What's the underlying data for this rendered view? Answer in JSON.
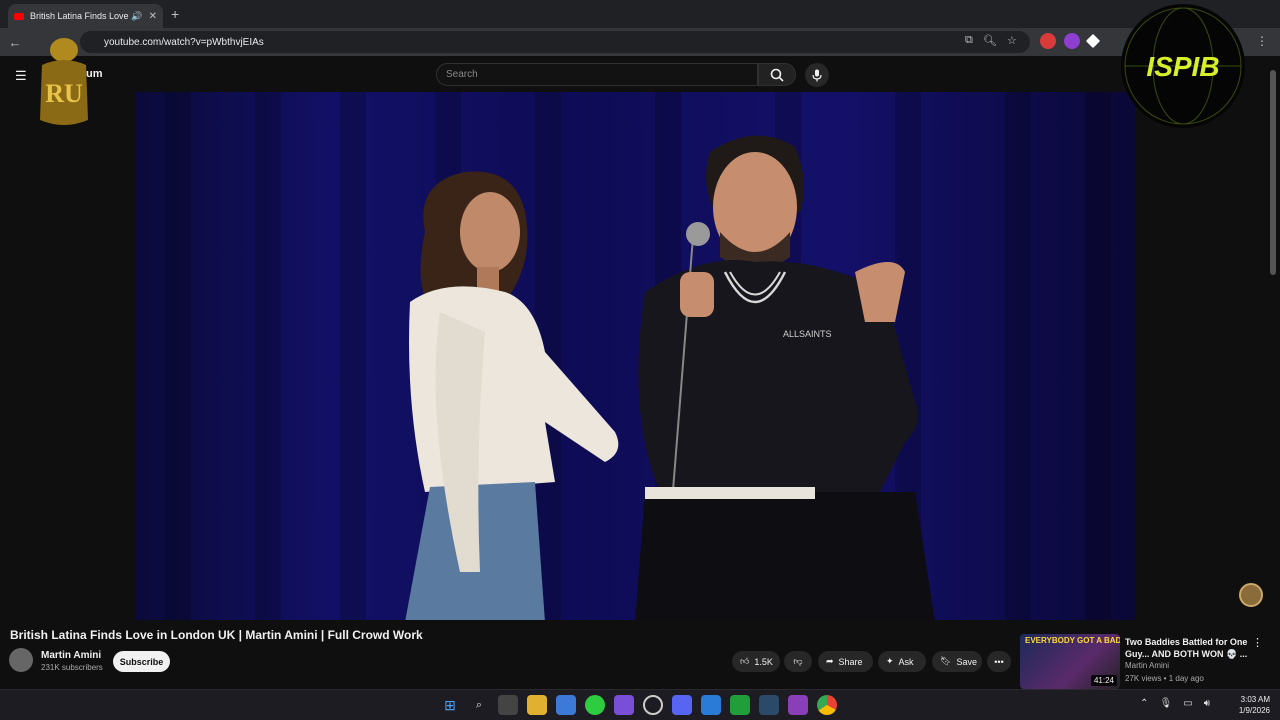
{
  "browser": {
    "tab_title": "British Latina Finds Love in",
    "url": "youtube.com/watch?v=pWbthvjEIAs"
  },
  "youtube": {
    "logo_suffix": "um",
    "search_placeholder": "Search"
  },
  "video": {
    "title": "British Latina Finds Love in London UK | Martin Amini | Full Crowd Work",
    "channel": "Martin Amini",
    "subscribers": "231K subscribers",
    "subscribe_label": "Subscribe",
    "likes": "1.5K",
    "share_label": "Share",
    "ask_label": "Ask",
    "save_label": "Save",
    "shirt_text": "ALLSAINTS"
  },
  "related": {
    "thumb_text": "EVERYBODY GOT A BADDIE",
    "title": "Two Baddies Battled for One Guy... AND BOTH WON 💀 ...",
    "channel": "Martin Amini",
    "meta": "27K views • 1 day ago",
    "duration": "41:24"
  },
  "watermarks": {
    "left_text": "RU",
    "right_text": "ISPIB"
  },
  "taskbar": {
    "time": "3:03 AM",
    "date": "1/9/2026"
  },
  "colors": {
    "youtube_red": "#ff0000",
    "background": "#0f0f0f"
  }
}
